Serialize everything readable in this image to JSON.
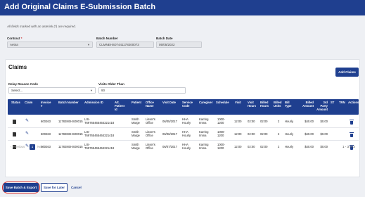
{
  "header": {
    "title": "Add Original Claims E-Submission Batch"
  },
  "form": {
    "required_note": "All fields marked with an asterisk (*) are required.",
    "contract": {
      "label": "Contract",
      "required_mark": "*",
      "value": "Aetna"
    },
    "batch_number": {
      "label": "Batch Number",
      "value": "CLMNEHS07441178200073"
    },
    "batch_date": {
      "label": "Batch Date",
      "value": "05/05/2022"
    }
  },
  "claims": {
    "title": "Claims",
    "add_button": "Add Claims",
    "delay_reason": {
      "label": "Delay Reason Code",
      "value": "Select..."
    },
    "visits_older": {
      "label": "Visits Older Than",
      "value": "90"
    },
    "columns": {
      "status": "Status",
      "claim": "Claim",
      "invoice": [
        "Invoice",
        "#"
      ],
      "batch_number": "Batch Number",
      "admission_id": "Admission ID",
      "alt_patient_id": [
        "Alt.",
        "Patient",
        "Id"
      ],
      "patient": "Patient",
      "office_name": [
        "Office",
        "Name"
      ],
      "visit_date": "Visit Date",
      "service_code": [
        "Service",
        "Code"
      ],
      "caregiver": "Caregiver",
      "schedule": "Schedule",
      "visit": "Visit",
      "visit_hours": [
        "Visit",
        "Hours"
      ],
      "billed_hours": [
        "Billed",
        "Hours"
      ],
      "billed_units": [
        "Billed",
        "Units"
      ],
      "bill_type": [
        "Bill",
        "Type"
      ],
      "billed_amount": [
        "Billed",
        "Amount"
      ],
      "third_party_amount": [
        "3rd",
        "Party",
        "Amount"
      ],
      "st": "ST",
      "trn": "TRN",
      "actions": "Actions"
    },
    "rows": [
      {
        "invoice": "600263",
        "batch_number": "11782NEHS00015",
        "admission_id": [
          "LIS-",
          "T69765465464321418"
        ],
        "patient": [
          "Smith",
          "Marge"
        ],
        "office": [
          "Lisset's",
          "Office"
        ],
        "visit_date": "06/05/2017",
        "service_code": [
          "HHA",
          "Hourly"
        ],
        "caregiver": [
          "Karring",
          "Imma"
        ],
        "schedule": [
          "1000-",
          "1200"
        ],
        "visit": "12:00",
        "visit_hours": "02:00",
        "billed_hours": "02:00",
        "billed_units": "2",
        "bill_type": "Hourly",
        "billed_amount": "$40.00",
        "third_party_amount": "$0.00"
      },
      {
        "invoice": "600263",
        "batch_number": "11782NEHS00015",
        "admission_id": [
          "LIS-",
          "T69765465464321418"
        ],
        "patient": [
          "Smith",
          "Marge"
        ],
        "office": [
          "Lisset's",
          "Office"
        ],
        "visit_date": "06/06/2017",
        "service_code": [
          "HHA",
          "Hourly"
        ],
        "caregiver": [
          "Karring",
          "Imma"
        ],
        "schedule": [
          "1000-",
          "1200"
        ],
        "visit": "12:00",
        "visit_hours": "02:00",
        "billed_hours": "02:00",
        "billed_units": "2",
        "bill_type": "Hourly",
        "billed_amount": "$40.00",
        "third_party_amount": "$0.00"
      },
      {
        "invoice": "600263",
        "batch_number": "11782NEHS00015",
        "admission_id": [
          "LIS-",
          "T69765465464321418"
        ],
        "patient": [
          "Smith",
          "Marge"
        ],
        "office": [
          "Lisset's",
          "Office"
        ],
        "visit_date": "06/07/2017",
        "service_code": [
          "HHA",
          "Hourly"
        ],
        "caregiver": [
          "Karring",
          "Imma"
        ],
        "schedule": [
          "1000-",
          "1200"
        ],
        "visit": "12:00",
        "visit_hours": "02:00",
        "billed_hours": "02:00",
        "billed_units": "2",
        "bill_type": "Hourly",
        "billed_amount": "$40.00",
        "third_party_amount": "$0.00"
      }
    ],
    "pagination": {
      "previous": "Previous",
      "current_page": "1",
      "next": "Next",
      "count": "1 - 3 of 3"
    }
  },
  "footer": {
    "save_export": "Save Batch & Export",
    "save_later": "Save for Later",
    "cancel": "Cancel"
  },
  "colors": {
    "primary": "#1f3f8f",
    "highlight_ring": "#d42a2a"
  },
  "icons": {
    "status": "document-icon",
    "claim": "edit-icon",
    "actions": "trash-icon"
  }
}
